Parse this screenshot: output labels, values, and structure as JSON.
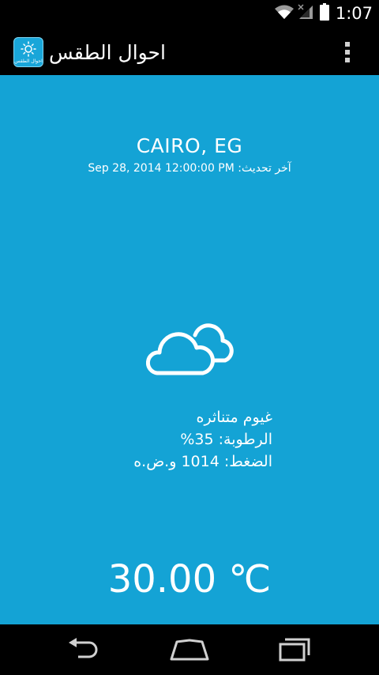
{
  "status_bar": {
    "time": "1:07",
    "icons": [
      "wifi-icon",
      "signal-icon",
      "battery-icon"
    ]
  },
  "action_bar": {
    "title": "احوال الطقس",
    "app_icon_label": "احوال الطقس",
    "overflow_icon": "more-vertical-icon"
  },
  "weather": {
    "city": "CAIRO, EG",
    "last_updated": "آخر تحديث: Sep 28, 2014 12:00:00 PM",
    "condition_icon": "cloud-icon",
    "description": "غيوم متناثره",
    "humidity": "الرطوبة: 35%",
    "pressure": "الضغط: 1014 و.ض.ه",
    "temperature": "30.00 ℃"
  },
  "colors": {
    "background": "#14a3d5",
    "bars": "#000000",
    "text": "#ffffff"
  },
  "nav_bar": {
    "icons": [
      "back-icon",
      "home-icon",
      "recent-apps-icon"
    ]
  }
}
